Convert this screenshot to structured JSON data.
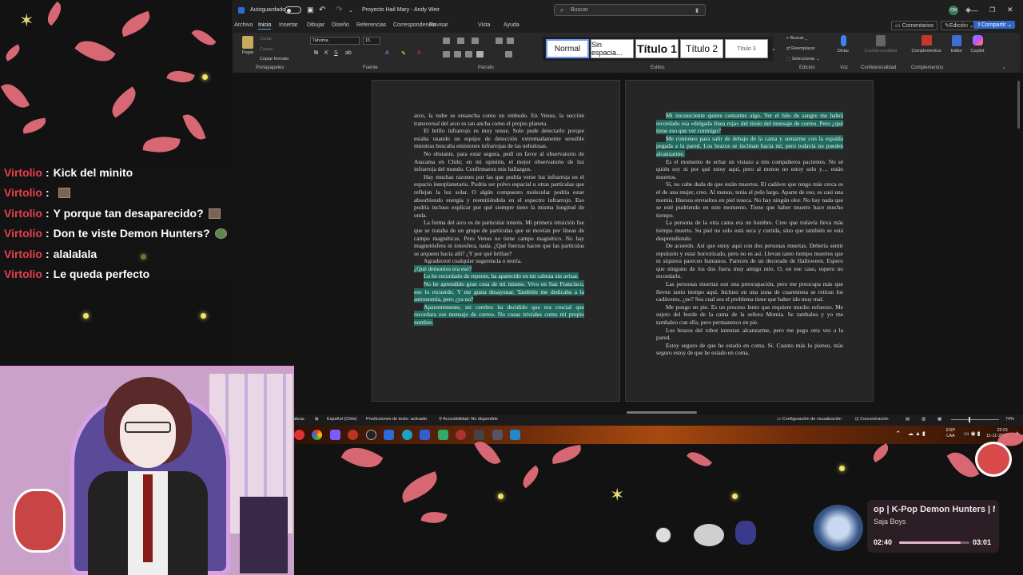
{
  "word": {
    "autosave_label": "Autoguardado",
    "doc_title": "Proyecto Hail Mary - Andy Weir",
    "search_placeholder": "Buscar",
    "user_initials": "CM",
    "menu": [
      "Archivo",
      "Inicio",
      "Insertar",
      "Dibujar",
      "Diseño",
      "Referencias",
      "Correspondencia",
      "Revisar",
      "Vista",
      "Ayuda"
    ],
    "comments_label": "Comentarios",
    "edit_mode_label": "Edición",
    "share_label": "Compartir",
    "ribbon": {
      "paste": "Pegar",
      "cut": "Cortar",
      "copy": "Copiar",
      "format_painter": "Copiar formato",
      "clipboard_group": "Portapapeles",
      "font_name": "Tahoma",
      "font_size": "15",
      "font_group": "Fuente",
      "paragraph_group": "Párrafo",
      "styles": [
        "Normal",
        "Sin espacia...",
        "Título 1",
        "Título 2",
        "Título 3"
      ],
      "styles_group": "Estilos",
      "find": "Buscar",
      "replace": "Reemplazar",
      "select": "Seleccionar",
      "editing_group": "Edición",
      "dictate": "Dictar",
      "voice_group": "Voz",
      "sensitivity": "Confidencialidad",
      "sensitivity_group": "Confidencialidad",
      "addins": "Complementos",
      "addins_group": "Complementos",
      "editor": "Editor",
      "copilot": "Copilot"
    },
    "left_page": [
      {
        "text": "arco, la nube se ensancha como un embudo. En Venus, la sección transversal del arco es tan ancha como el propio planeta.",
        "indent": false,
        "hl": false
      },
      {
        "text": "El brillo infrarrojo es muy tenue. Solo pude detectarlo porque estaba usando un equipo de detección extremadamente sensible mientras buscaba emisiones infrarrojas de las nebulosas.",
        "indent": true,
        "hl": false
      },
      {
        "text": "No obstante, para estar segura, pedí un favor al observatorio de Atacama en Chile; en mi opinión, el mejor observatorio de luz infrarroja del mundo. Confirmaron mis hallazgos.",
        "indent": true,
        "hl": false
      },
      {
        "text": "Hay muchas razones por las que podría verse luz infrarroja en el espacio interplanetario. Podría ser polvo espacial u otras partículas que reflejan la luz solar. O algún compuesto molecular podría estar absorbiendo energía y reemitiéndola en el espectro infrarrojo. Eso podría incluso explicar por qué siempre tiene la misma longitud de onda.",
        "indent": true,
        "hl": false
      },
      {
        "text": "La forma del arco es de particular interés. Mi primera intuición fue que se trataba de un grupo de partículas que se movían por líneas de campo magnéticas. Pero Venus no tiene campo magnético. No hay magnetósfera ni ionosfera, nada. ¿Qué fuerzas hacen que las partículas se arqueen hacia allí? ¿Y por qué brillan?",
        "indent": true,
        "hl": false
      },
      {
        "text": "Agradeceré cualquier sugerencia o teoría.",
        "indent": true,
        "hl": false
      },
      {
        "text": "¿Qué demonios era eso?",
        "indent": false,
        "hl": true
      },
      {
        "text": "Lo he recordado de repente, ha aparecido en mi cabeza sin avisar.",
        "indent": true,
        "hl": true
      },
      {
        "text": "No he aprendido gran cosa de mí mismo. Vivo en San Francisco, eso lo recuerdo. Y me gusta desayunar. También me dedicaba a la astronomía, pero ¿ya no?",
        "indent": true,
        "hl": true
      },
      {
        "text": "Aparentemente, mi cerebro ha decidido que era crucial que recordara ese mensaje de correo. No cosas triviales como mi propio nombre.",
        "indent": true,
        "hl": true
      }
    ],
    "right_page": [
      {
        "text": "Mi inconsciente quiere contarme algo. Ver el hilo de sangre me habrá recordado esa «delgada línea roja» del título del mensaje de correo. Pero ¿qué tiene eso que ver conmigo?",
        "indent": true,
        "hl": true
      },
      {
        "text": "Me contoneo para salir de debajo de la cama y sentarme con la espalda pegada a la pared. Los brazos se inclinan hacia mí, pero todavía no pueden alcanzarme.",
        "indent": true,
        "hl": true
      },
      {
        "text": "Es el momento de echar un vistazo a mis compañeros pacientes. No sé quién soy ni por qué estoy aquí, pero al menos no estoy solo y… están muertos.",
        "indent": true,
        "hl": false
      },
      {
        "text": "Sí, no cabe duda de que están muertos. El cadáver que tengo más cerca es el de una mujer, creo. Al menos, tenía el pelo largo. Aparte de eso, es casi una momia. Huesos envueltos en piel reseca. No hay ningún olor. No hay nada que se esté pudriendo en este momento. Tiene que haber muerto hace mucho tiempo.",
        "indent": true,
        "hl": false
      },
      {
        "text": "La persona de la otra cama era un hombre. Creo que todavía lleva más tiempo muerto. Su piel no solo está seca y curtida, sino que también se está desprendiendo.",
        "indent": true,
        "hl": false
      },
      {
        "text": "De acuerdo. Así que estoy aquí con dos personas muertas. Debería sentir repulsión y estar horrorizado, pero no es así. Llevan tanto tiempo muertos que ni siquiera parecen humanos. Parecen de un decorado de Halloween. Espero que ninguno de los dos fuera muy amigo mío. O, en ese caso, espero no recordarlo.",
        "indent": true,
        "hl": false
      },
      {
        "text": "Las personas muertas son una preocupación, pero me preocupa más que lleven tanto tiempo aquí. Incluso en una zona de cuarentena se retiran los cadáveres, ¿no? Sea cual sea el problema tiene que haber ido muy mal.",
        "indent": true,
        "hl": false
      },
      {
        "text": "Me pongo en pie. Es un proceso lento que requiere mucho esfuerzo. Me sujeto del borde de la cama de la señora Momia. Se tambalea y yo me tambaleo con ella, pero permanezco en pie.",
        "indent": true,
        "hl": false
      },
      {
        "text": "Los brazos del robot intentan alcanzarme, pero me pego otra vez a la pared.",
        "indent": true,
        "hl": false
      },
      {
        "text": "Estoy seguro de que he estado en coma. Sí. Cuanto más lo pienso, más seguro estoy de que he estado en coma.",
        "indent": true,
        "hl": false
      }
    ],
    "status": {
      "words_label": "abras",
      "language": "Español (Chile)",
      "predictions": "Predicciones de texto: activado",
      "accessibility": "Accesibilidad: No disponible",
      "display_settings": "Configuración de visualización",
      "focus": "Concentración",
      "zoom": "74%"
    }
  },
  "chat": {
    "messages": [
      {
        "user": "Virtolio",
        "text": "Kick del minito",
        "emote": ""
      },
      {
        "user": "Virtolio",
        "text": "",
        "emote": "cat"
      },
      {
        "user": "Virtolio",
        "text": "Y porque tan desaparecido?",
        "emote": "cat"
      },
      {
        "user": "Virtolio",
        "text": "Don te viste Demon Hunters?",
        "emote": "green"
      },
      {
        "user": "Virtolio",
        "text": "alalalala",
        "emote": ""
      },
      {
        "user": "Virtolio",
        "text": "Le queda perfecto",
        "emote": ""
      }
    ]
  },
  "taskbar": {
    "lang": "ESP",
    "region": "LAA",
    "time": "22:01",
    "date": "11-11-2025"
  },
  "now_playing": {
    "title": "op | K-Pop Demon Hunters | N",
    "artist": "Saja Boys",
    "elapsed": "02:40",
    "duration": "03:01",
    "progress": 0.88
  },
  "colors": {
    "petal": "#e8707c",
    "highlight": "#1f6b5e",
    "chat_user": "#e8404e"
  }
}
